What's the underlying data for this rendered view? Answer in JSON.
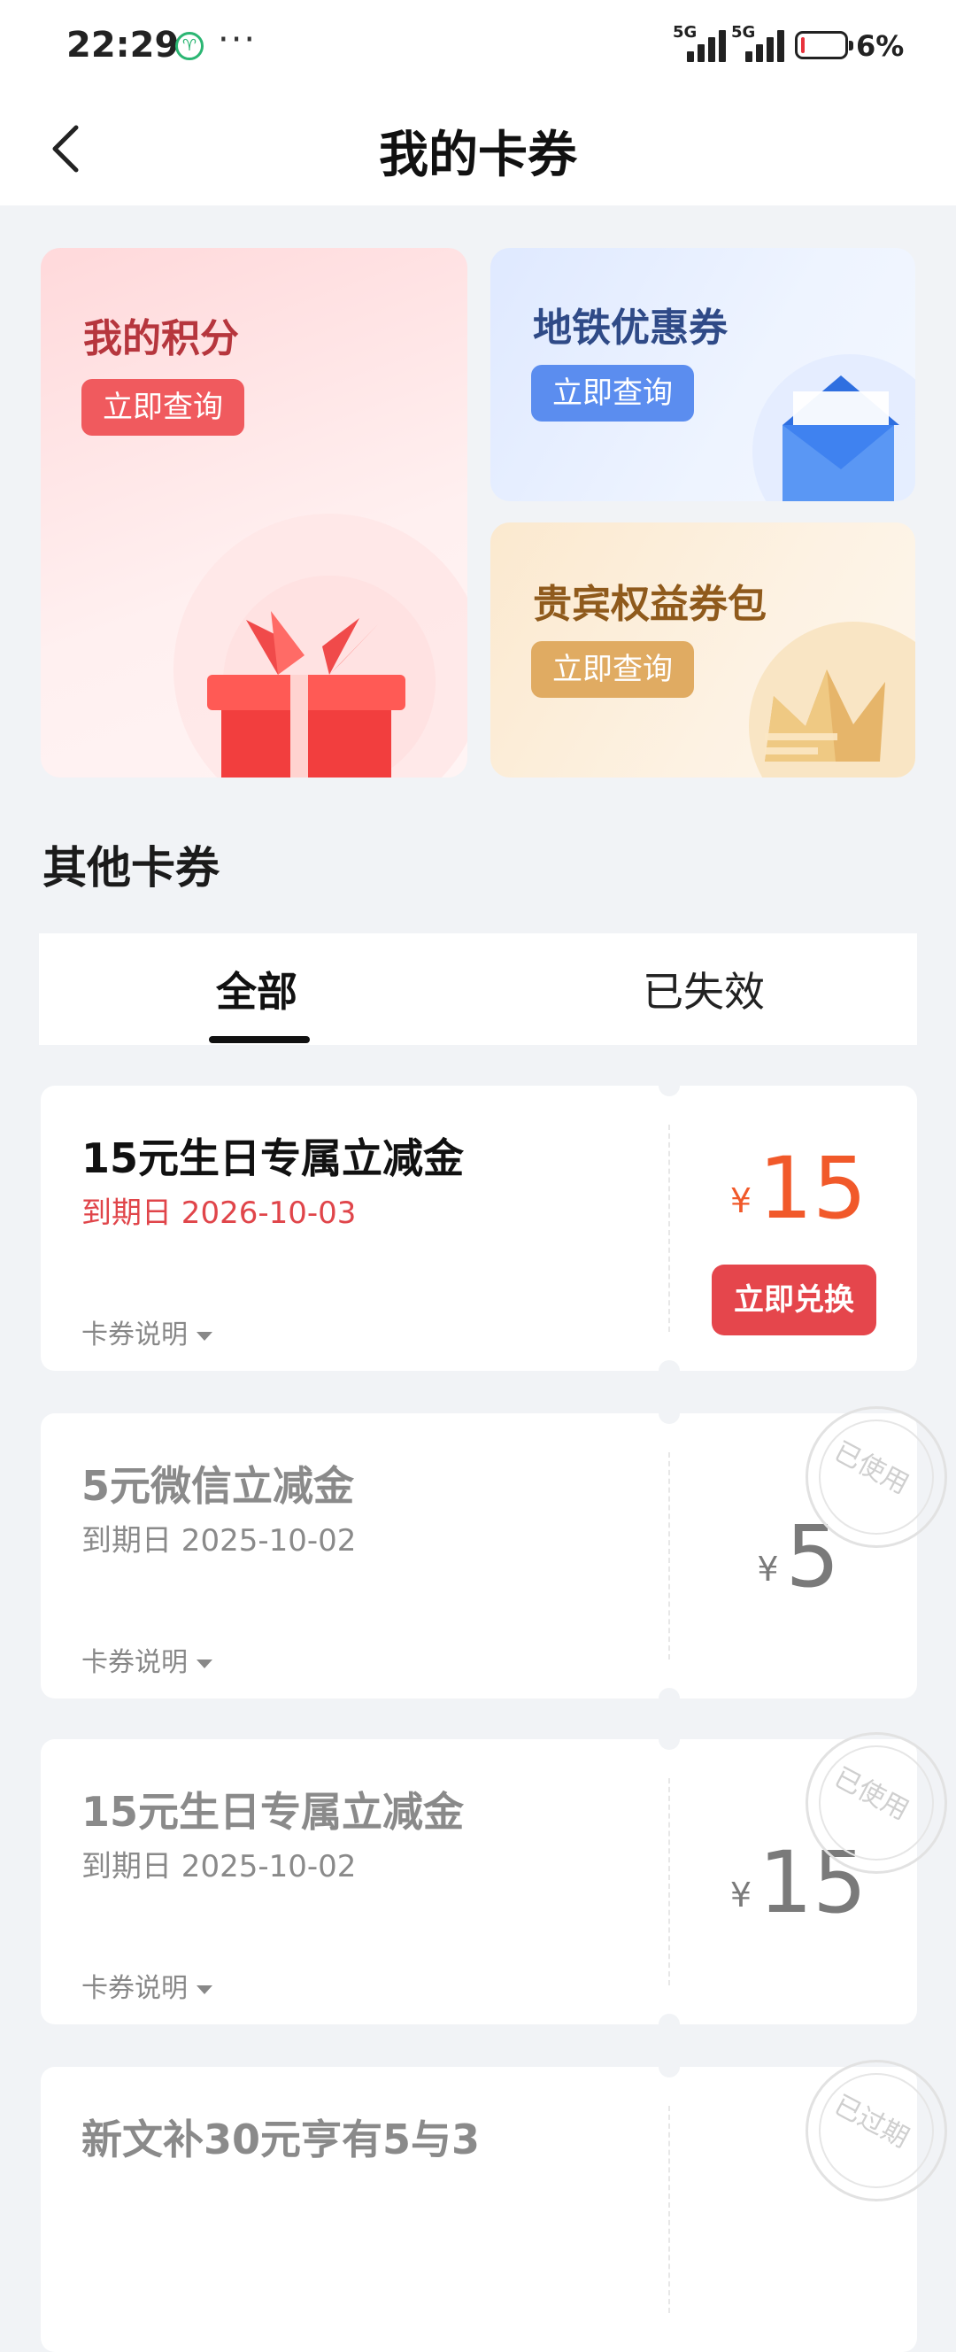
{
  "status_bar": {
    "time": "22:29",
    "dots": "···",
    "network_1": "5G",
    "network_2": "5G",
    "battery_percent": "6%",
    "battery_level": 0.06
  },
  "nav": {
    "title": "我的卡券"
  },
  "cards": {
    "points": {
      "title": "我的积分",
      "button": "立即查询"
    },
    "metro": {
      "title": "地铁优惠券",
      "button": "立即查询"
    },
    "vip": {
      "title": "贵宾权益券包",
      "button": "立即查询"
    }
  },
  "section": {
    "title": "其他卡券"
  },
  "tabs": [
    {
      "label": "全部",
      "selected": true
    },
    {
      "label": "已失效",
      "selected": false
    }
  ],
  "coupons": [
    {
      "name": "15元生日专属立减金",
      "expiry": "到期日 2026-10-03",
      "description": "卡券说明",
      "currency": "¥",
      "amount": "15",
      "action": "立即兑换",
      "status": "active"
    },
    {
      "name": "5元微信立减金",
      "expiry": "到期日 2025-10-02",
      "description": "卡券说明",
      "currency": "¥",
      "amount": "5",
      "stamp": "已使用",
      "status": "used"
    },
    {
      "name": "15元生日专属立减金",
      "expiry": "到期日 2025-10-02",
      "description": "卡券说明",
      "currency": "¥",
      "amount": "15",
      "stamp": "已使用",
      "status": "used"
    },
    {
      "name": "新文补30元亨有5与3",
      "stamp": "已过期",
      "status": "expired"
    }
  ],
  "colors": {
    "accent_red": "#e5464c",
    "amount_orange": "#f1592a",
    "metro_blue": "#5b8def",
    "vip_gold": "#e0ab62"
  }
}
